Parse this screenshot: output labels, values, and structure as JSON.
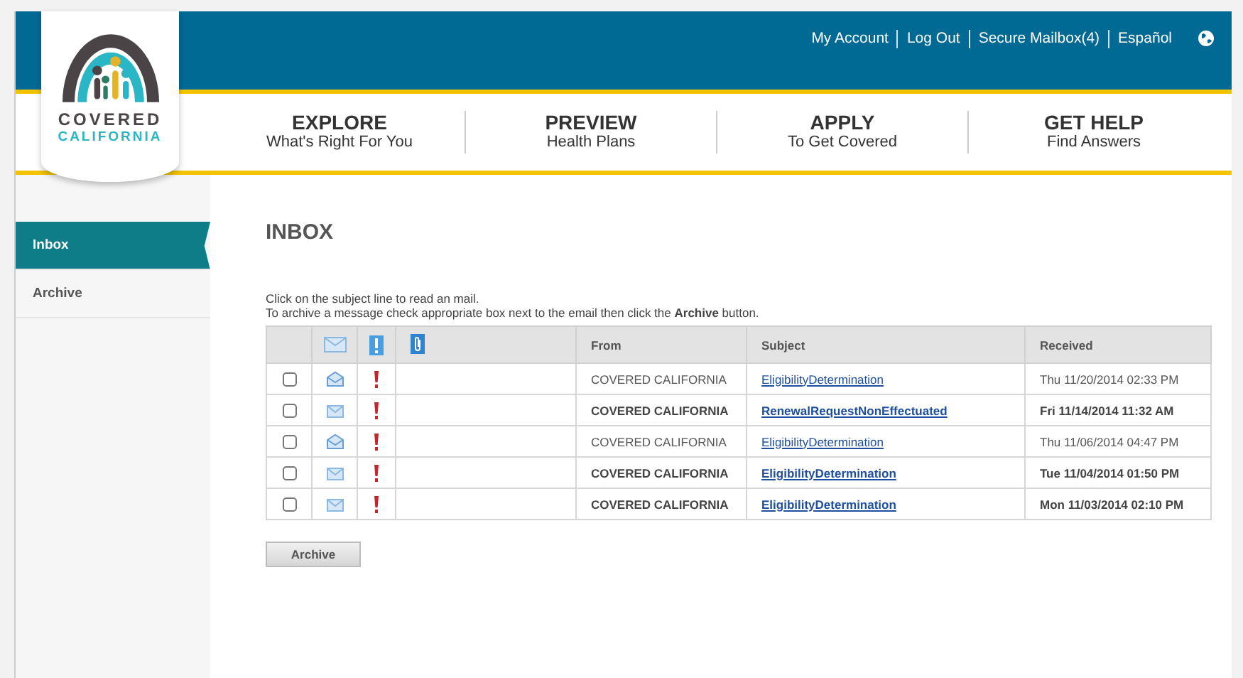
{
  "logo": {
    "line_1": "COVERED",
    "line_2": "CALIFORNIA"
  },
  "top_links": [
    "My Account",
    "Log Out",
    "Secure Mailbox(4)",
    "Español"
  ],
  "nav": [
    {
      "title": "EXPLORE",
      "subtitle": "What's Right For You"
    },
    {
      "title": "PREVIEW",
      "subtitle": "Health Plans"
    },
    {
      "title": "APPLY",
      "subtitle": "To Get Covered"
    },
    {
      "title": "GET HELP",
      "subtitle": "Find Answers"
    }
  ],
  "sidebar": {
    "items": [
      {
        "label": "Inbox",
        "selected": true
      },
      {
        "label": "Archive",
        "selected": false
      }
    ]
  },
  "page_title": "INBOX",
  "instructions": [
    "Click on the subject line to read an mail.",
    "To archive a message check appropriate box next to the email then click the **Archive** button."
  ],
  "table": {
    "columns": [
      "From",
      "Subject",
      "Received"
    ],
    "rows": [
      {
        "checked": false,
        "read": true,
        "from": "COVERED CALIFORNIA",
        "subject": "EligibilityDetermination",
        "received": "Thu 11/20/2014 02:33 PM"
      },
      {
        "checked": false,
        "read": false,
        "from": "COVERED CALIFORNIA",
        "subject": "RenewalRequestNonEffectuated",
        "received": "Fri 11/14/2014 11:32 AM"
      },
      {
        "checked": false,
        "read": true,
        "from": "COVERED CALIFORNIA",
        "subject": "EligibilityDetermination",
        "received": "Thu 11/06/2014 04:47 PM"
      },
      {
        "checked": false,
        "read": false,
        "from": "COVERED CALIFORNIA",
        "subject": "EligibilityDetermination",
        "received": "Tue 11/04/2014 01:50 PM"
      },
      {
        "checked": false,
        "read": false,
        "from": "COVERED CALIFORNIA",
        "subject": "EligibilityDetermination",
        "received": "Mon 11/03/2014 02:10 PM"
      }
    ]
  },
  "archive_button": "Archive"
}
